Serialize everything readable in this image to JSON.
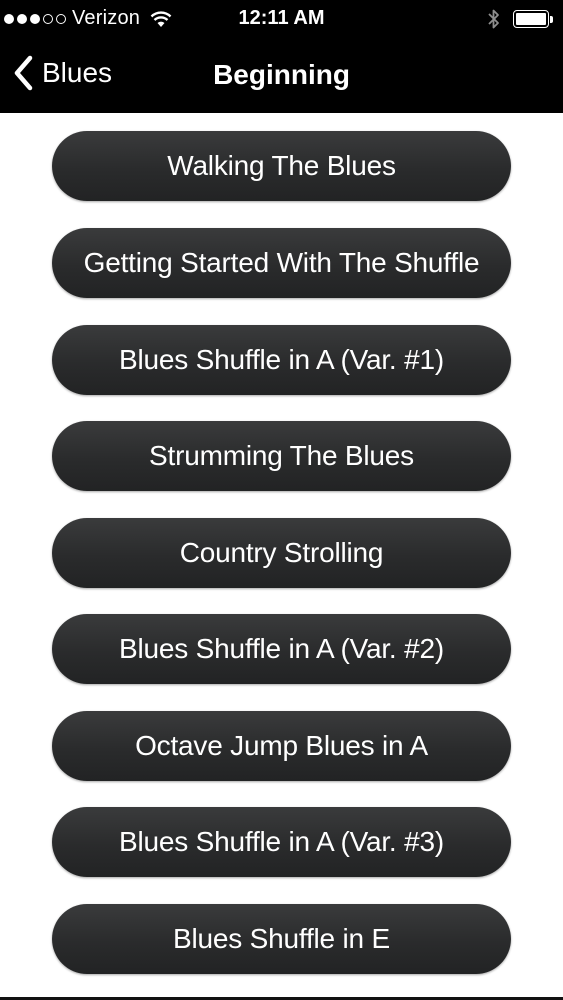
{
  "status_bar": {
    "carrier": "Verizon",
    "signal_bars_filled": 3,
    "signal_bars_total": 5,
    "time": "12:11 AM",
    "icons": [
      "wifi-icon",
      "bluetooth-icon",
      "battery-icon"
    ],
    "battery_level": 1.0
  },
  "nav": {
    "back_label": "Blues",
    "title": "Beginning"
  },
  "colors": {
    "nav_background": "#000000",
    "button_background": "#2c2d2e",
    "button_text": "#ffffff",
    "page_background": "#ffffff"
  },
  "lessons": [
    {
      "label": "Walking The Blues"
    },
    {
      "label": "Getting Started With The Shuffle"
    },
    {
      "label": "Blues Shuffle in A (Var. #1)"
    },
    {
      "label": "Strumming The Blues"
    },
    {
      "label": "Country Strolling"
    },
    {
      "label": "Blues Shuffle in A (Var. #2)"
    },
    {
      "label": "Octave Jump Blues in A"
    },
    {
      "label": "Blues Shuffle in A (Var. #3)"
    },
    {
      "label": "Blues Shuffle in E"
    }
  ]
}
